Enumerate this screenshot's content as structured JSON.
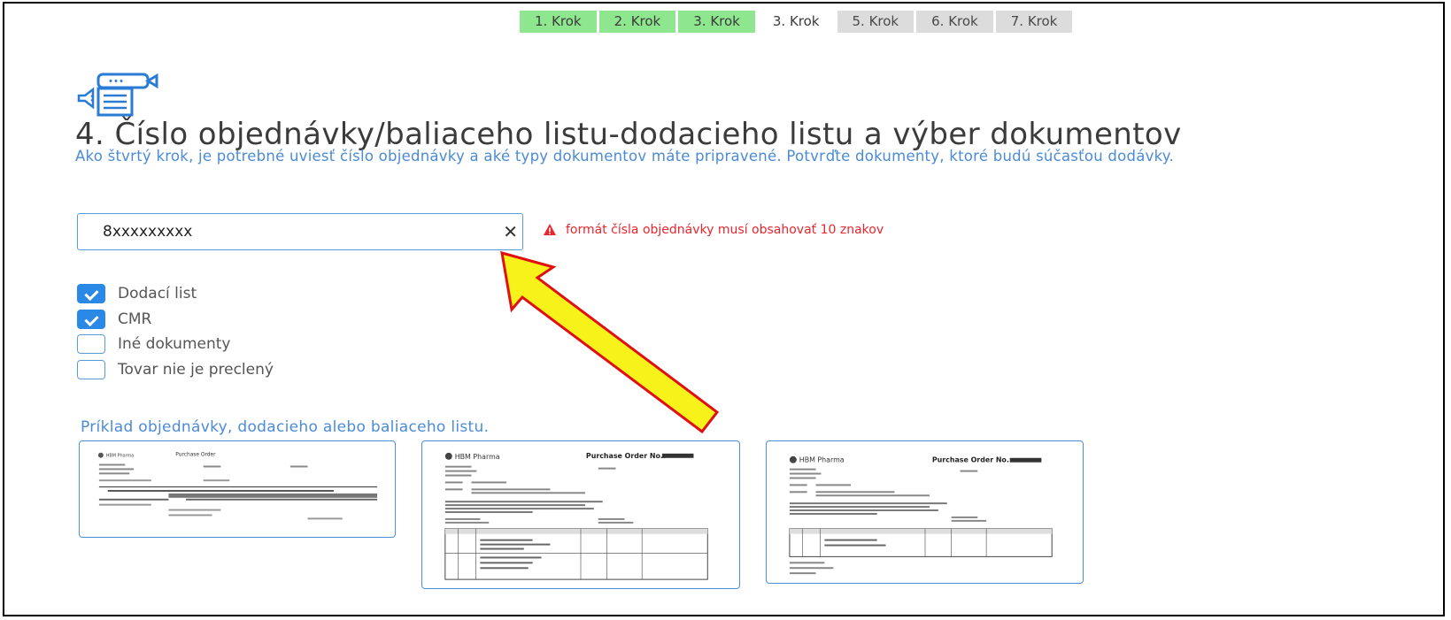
{
  "steps": [
    {
      "label": "1. Krok",
      "state": "done"
    },
    {
      "label": "2. Krok",
      "state": "done"
    },
    {
      "label": "3. Krok",
      "state": "done"
    },
    {
      "label": "3. Krok",
      "state": "current"
    },
    {
      "label": "5. Krok",
      "state": "todo"
    },
    {
      "label": "6. Krok",
      "state": "todo"
    },
    {
      "label": "7. Krok",
      "state": "todo"
    }
  ],
  "header": {
    "icon": "document-megaphone-icon",
    "title": "4. Číslo objednávky/baliaceho listu-dodacieho listu a výber dokumentov",
    "subtitle": "Ako štvrtý krok, je potrebné uviesť číslo objednávky a aké typy dokumentov máte pripravené. Potvrďte dokumenty, ktoré budú súčasťou dodávky."
  },
  "order": {
    "value": "8xxxxxxxxx",
    "clear_symbol": "✕",
    "error": "formát čísla objednávky musí obsahovať 10 znakov"
  },
  "documents": [
    {
      "label": "Dodací list",
      "checked": true
    },
    {
      "label": "CMR",
      "checked": true
    },
    {
      "label": "Iné dokumenty",
      "checked": false
    },
    {
      "label": "Tovar nie je preclený",
      "checked": false
    }
  ],
  "examples": {
    "label": "Príklad objednávky, dodacieho alebo baliaceho listu.",
    "thumbnails": [
      {
        "title": "Purchase Order",
        "company": "HBM Pharma"
      },
      {
        "title": "Purchase Order No.:",
        "company": "HBM Pharma"
      },
      {
        "title": "Purchase Order No.:",
        "company": "HBM Pharma"
      }
    ]
  },
  "colors": {
    "step_done": "#8ee68e",
    "step_todo": "#dcdcdc",
    "accent_blue": "#4b8bd6",
    "error_red": "#e8262e",
    "arrow_fill": "#f7f31a",
    "arrow_stroke": "#e01010"
  }
}
